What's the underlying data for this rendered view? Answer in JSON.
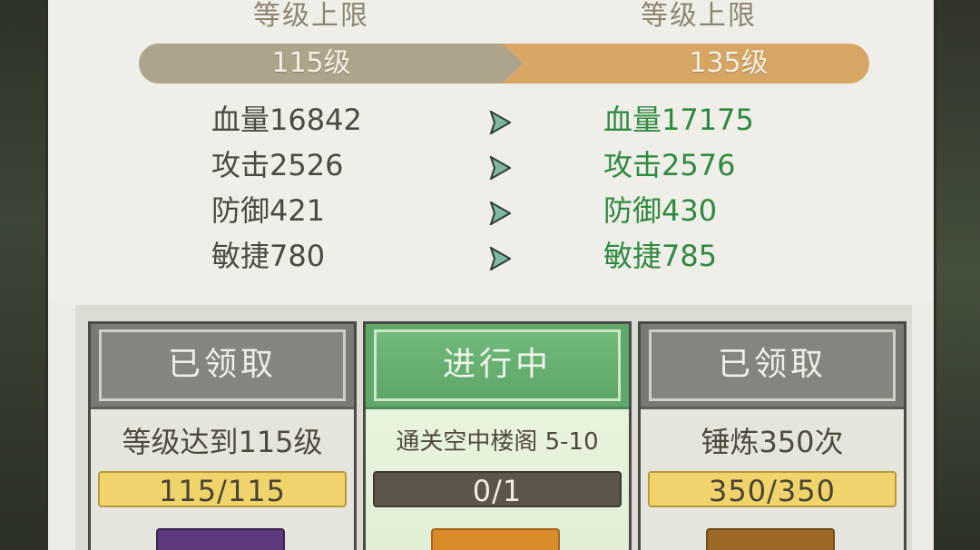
{
  "level_cap": {
    "current_label": "等级上限",
    "next_label": "等级上限",
    "current_value": "115级",
    "next_value": "135级"
  },
  "stats": {
    "old": [
      "血量16842",
      "攻击2526",
      "防御421",
      "敏捷780"
    ],
    "new": [
      "血量17175",
      "攻击2576",
      "防御430",
      "敏捷785"
    ]
  },
  "tasks": [
    {
      "status": "已领取",
      "title": "等级达到115级",
      "progress": "115/115",
      "progress_fraction": 1.0,
      "state": "claimed"
    },
    {
      "status": "进行中",
      "title": "通关空中楼阁 5-10",
      "progress": "0/1",
      "progress_fraction": 0.0,
      "state": "in_progress"
    },
    {
      "status": "已领取",
      "title": "锤炼350次",
      "progress": "350/350",
      "progress_fraction": 1.0,
      "state": "claimed"
    }
  ],
  "colors": {
    "bar_current": "#aea38b",
    "bar_next": "#d7a665",
    "stat_new": "#2f8a3f",
    "progress_full": "#f0d46b",
    "header_active": "#5fa76a"
  },
  "icons": {
    "arrow": "triangle-right-icon"
  }
}
